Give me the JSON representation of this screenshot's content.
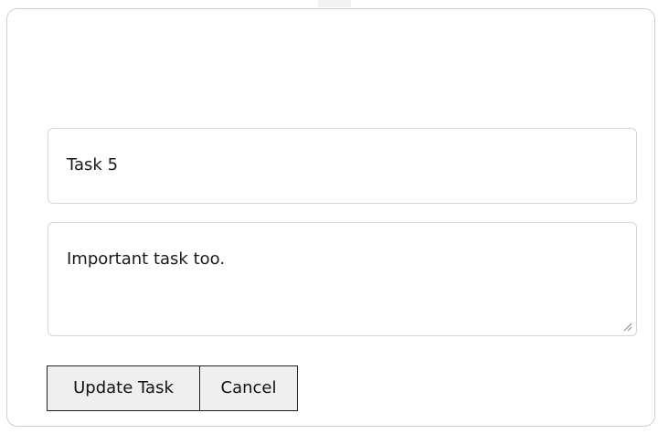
{
  "form": {
    "title_value": "Task 5",
    "description_value": "Important task too.",
    "update_label": "Update Task",
    "cancel_label": "Cancel"
  },
  "icons": {
    "resize_grip": "resize-grip-icon"
  },
  "colors": {
    "button_bg": "#efefef",
    "button_border": "#222222",
    "field_border": "#d6d6d6",
    "card_border": "#cfcfcf"
  }
}
